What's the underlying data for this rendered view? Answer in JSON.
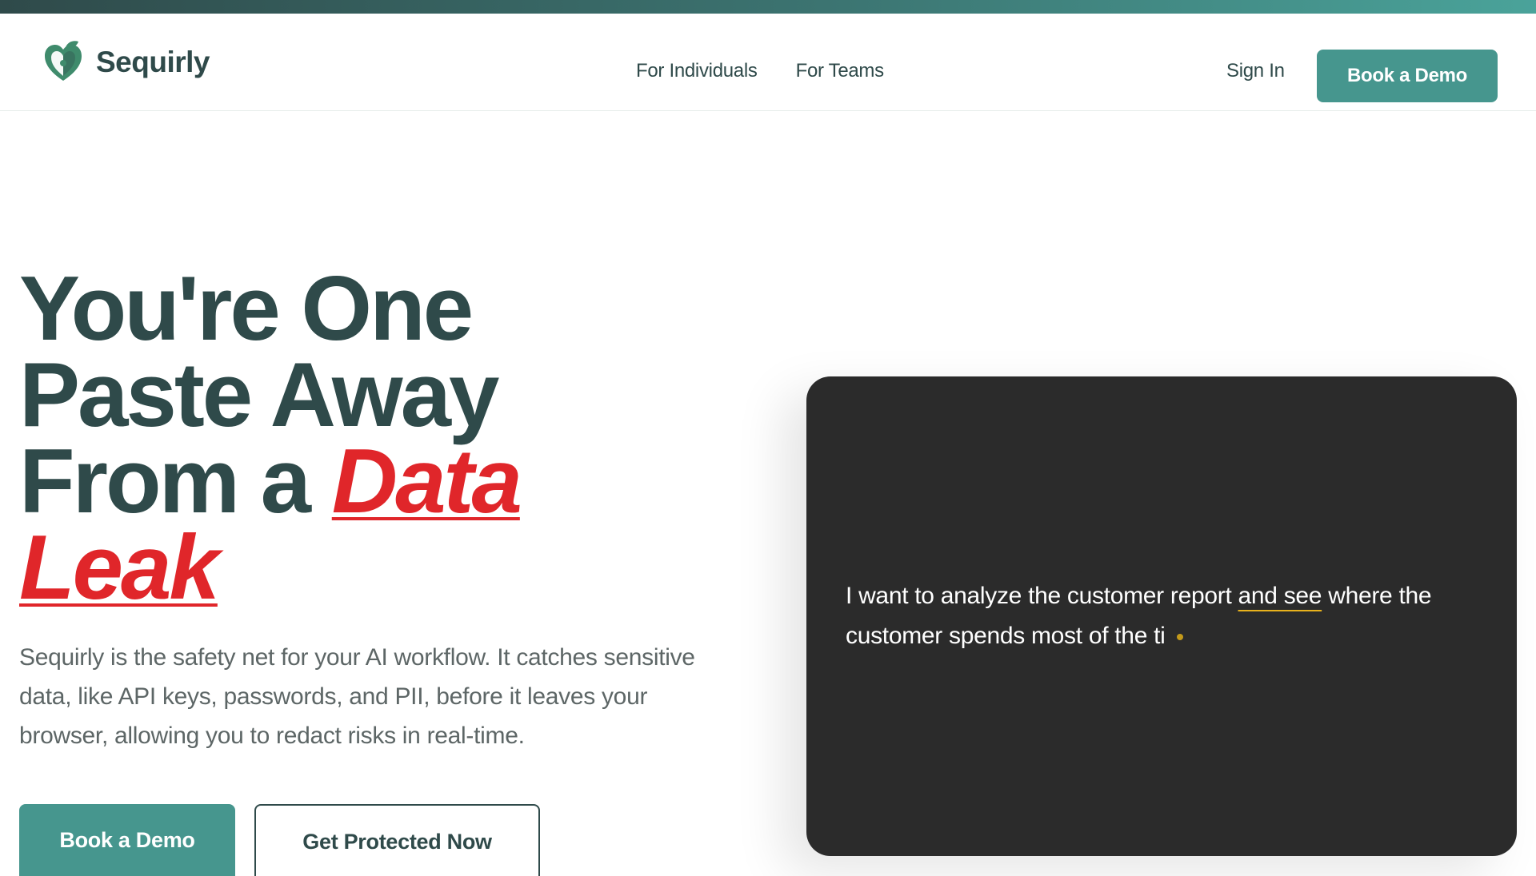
{
  "nav": {
    "brand": "Sequirly",
    "links": [
      "For Individuals",
      "For Teams"
    ],
    "sign_in": "Sign In",
    "cta": "Book a Demo"
  },
  "hero": {
    "title_lines": [
      "You're One",
      "Paste Away",
      "From a "
    ],
    "title_accent_1": "Data",
    "title_accent_2": "Leak",
    "description": "Sequirly is the safety net for your AI workflow. It catches sensitive data, like API keys, passwords, and PII, before it leaves your browser, allowing you to redact risks in real-time.",
    "primary_button": "Book a Demo",
    "secondary_button": "Get Protected Now"
  },
  "demo": {
    "text_before": "I want to analyze the customer report ",
    "highlight": "and see",
    "text_after": " where the customer spends most of the ti"
  },
  "colors": {
    "brand_teal": "#46968e",
    "dark_text": "#2f4a4a",
    "accent_red": "#e0262a",
    "card_bg": "#2b2b2b",
    "highlight_yellow": "#e8b21c"
  },
  "icons": {
    "brand_logo": "heart-shield-leaf-icon",
    "typing_cursor": "typing-cursor-dot-icon"
  }
}
